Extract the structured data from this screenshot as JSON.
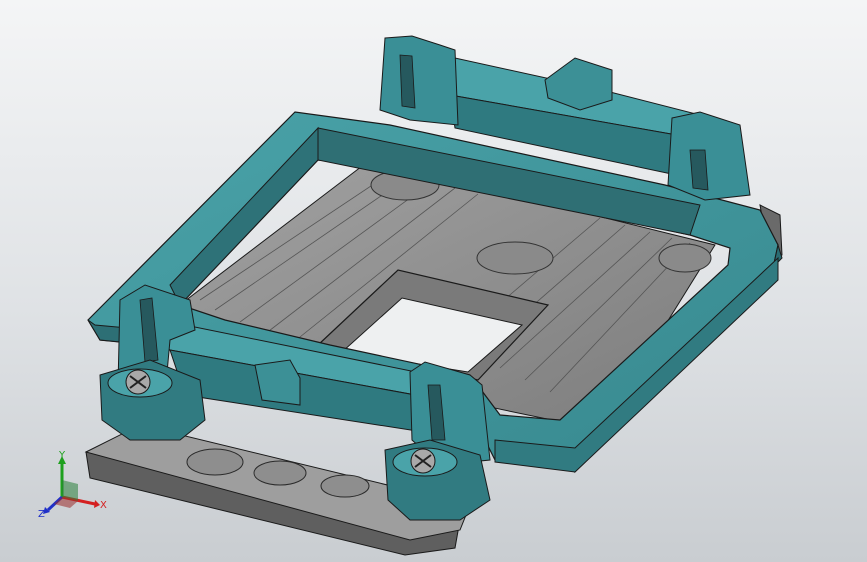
{
  "viewport": {
    "background_top": "#f4f5f6",
    "background_bottom": "#c9cdd1"
  },
  "model": {
    "frame_color": "#3a8f96",
    "frame_dark": "#2d6f75",
    "frame_light": "#5fb2b8",
    "plate_color": "#8c8c8c",
    "plate_dark": "#5e5e5e",
    "base_color": "#6f6f6f",
    "base_light": "#b5b5b5",
    "edge_color": "#1a1a1a"
  },
  "triad": {
    "x_label": "X",
    "y_label": "Y",
    "z_label": "Z",
    "x_color": "#d42020",
    "y_color": "#1ea01e",
    "z_color": "#2030c8"
  }
}
